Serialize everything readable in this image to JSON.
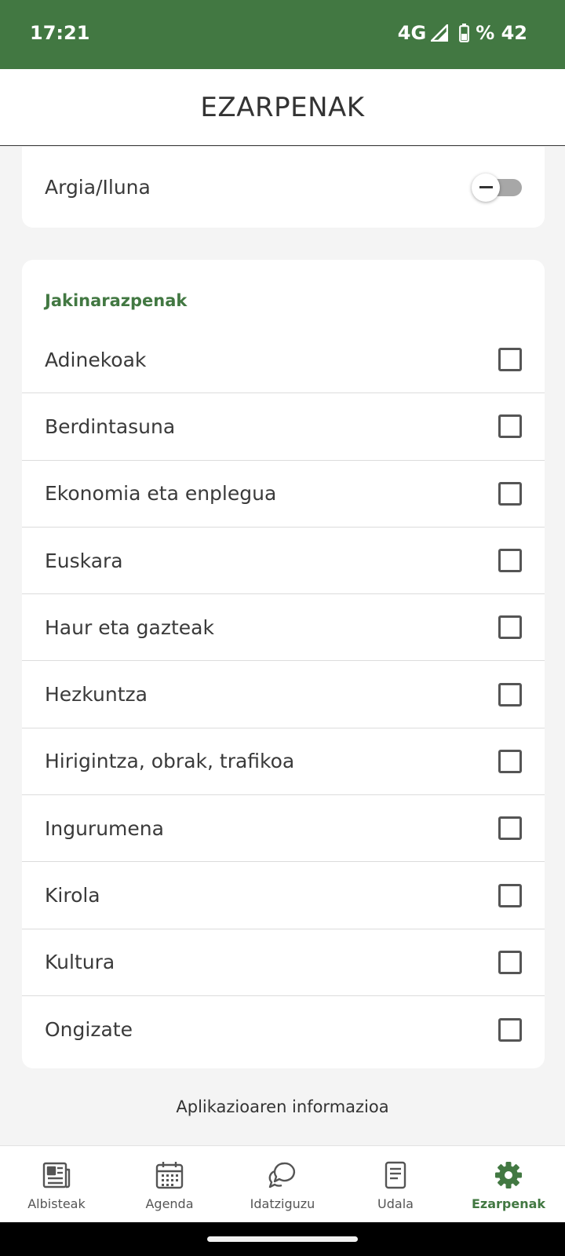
{
  "status_bar": {
    "time": "17:21",
    "network": "4G",
    "battery": "% 42"
  },
  "header": {
    "title": "EZARPENAK"
  },
  "theme": {
    "label": "Argia/Iluna",
    "enabled": false
  },
  "notifications": {
    "title": "Jakinarazpenak",
    "items": [
      {
        "label": "Adinekoak",
        "checked": false
      },
      {
        "label": "Berdintasuna",
        "checked": false
      },
      {
        "label": "Ekonomia eta enplegua",
        "checked": false
      },
      {
        "label": "Euskara",
        "checked": false
      },
      {
        "label": "Haur eta gazteak",
        "checked": false
      },
      {
        "label": "Hezkuntza",
        "checked": false
      },
      {
        "label": "Hirigintza, obrak, trafikoa",
        "checked": false
      },
      {
        "label": "Ingurumena",
        "checked": false
      },
      {
        "label": "Kirola",
        "checked": false
      },
      {
        "label": "Kultura",
        "checked": false
      },
      {
        "label": "Ongizate",
        "checked": false
      }
    ]
  },
  "footer": {
    "app_info": "Aplikazioaren informazioa"
  },
  "nav": {
    "items": [
      {
        "label": "Albisteak",
        "icon": "newspaper-icon"
      },
      {
        "label": "Agenda",
        "icon": "calendar-icon"
      },
      {
        "label": "Idatziguzu",
        "icon": "chat-icon"
      },
      {
        "label": "Udala",
        "icon": "document-icon"
      },
      {
        "label": "Ezarpenak",
        "icon": "gear-icon"
      }
    ],
    "active": "Ezarpenak"
  },
  "colors": {
    "primary": "#427842",
    "background": "#f4f4f4",
    "text": "#3a3a3a"
  }
}
